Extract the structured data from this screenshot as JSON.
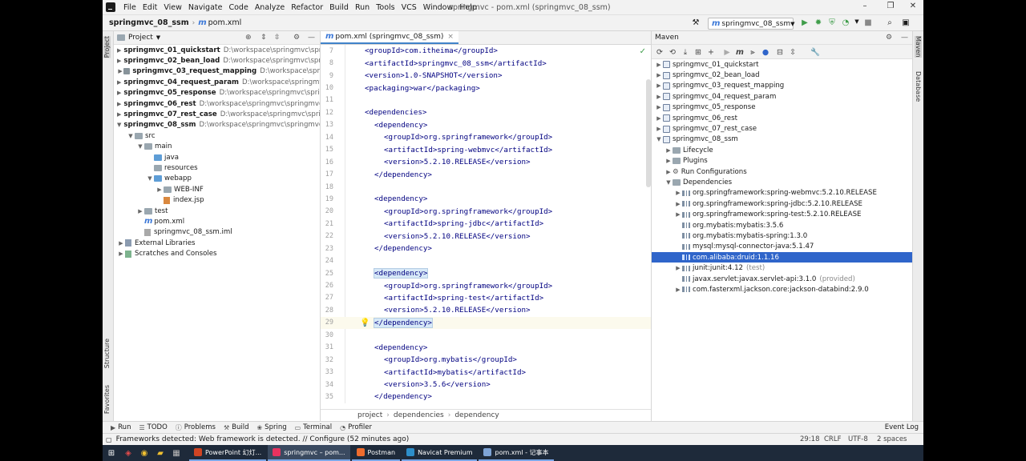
{
  "menubar": {
    "items": [
      "File",
      "Edit",
      "View",
      "Navigate",
      "Code",
      "Analyze",
      "Refactor",
      "Build",
      "Run",
      "Tools",
      "VCS",
      "Window",
      "Help"
    ],
    "title": "springmvc - pom.xml (springmvc_08_ssm)"
  },
  "navbar": {
    "project": "springmvc_08_ssm",
    "file": "pom.xml",
    "run_config": "springmvc_08_ssm"
  },
  "left_tabs": {
    "project": "Project",
    "structure": "Structure",
    "favorites": "Favorites"
  },
  "right_tabs": {
    "maven": "Maven",
    "database": "Database"
  },
  "project_panel": {
    "title": "Project",
    "modules": [
      {
        "name": "springmvc_01_quickstart",
        "path": "D:\\workspace\\springmvc\\spr"
      },
      {
        "name": "springmvc_02_bean_load",
        "path": "D:\\workspace\\springmvc\\spr"
      },
      {
        "name": "springmvc_03_request_mapping",
        "path": "D:\\workspace\\spr"
      },
      {
        "name": "springmvc_04_request_param",
        "path": "D:\\workspace\\springmv"
      },
      {
        "name": "springmvc_05_response",
        "path": "D:\\workspace\\springmvc\\sprin"
      },
      {
        "name": "springmvc_06_rest",
        "path": "D:\\workspace\\springmvc\\springmvc"
      },
      {
        "name": "springmvc_07_rest_case",
        "path": "D:\\workspace\\springmvc\\spri"
      },
      {
        "name": "springmvc_08_ssm",
        "path": "D:\\workspace\\springmvc\\springmvc"
      }
    ],
    "tree": {
      "src": "src",
      "main": "main",
      "java": "java",
      "resources": "resources",
      "webapp": "webapp",
      "webinf": "WEB-INF",
      "indexjsp": "index.jsp",
      "test": "test",
      "pom": "pom.xml",
      "iml": "springmvc_08_ssm.iml",
      "external": "External Libraries",
      "scratches": "Scratches and Consoles"
    }
  },
  "editor": {
    "tab": "pom.xml (springmvc_08_ssm)",
    "lines": [
      {
        "n": "7",
        "indent": 0,
        "code": "<groupId>com.itheima</groupId>"
      },
      {
        "n": "8",
        "indent": 0,
        "code": "<artifactId>springmvc_08_ssm</artifactId>"
      },
      {
        "n": "9",
        "indent": 0,
        "code": "<version>1.0-SNAPSHOT</version>"
      },
      {
        "n": "10",
        "indent": 0,
        "code": "<packaging>war</packaging>"
      },
      {
        "n": "11",
        "indent": 0,
        "code": ""
      },
      {
        "n": "12",
        "indent": 0,
        "code": "<dependencies>"
      },
      {
        "n": "13",
        "indent": 1,
        "code": "<dependency>"
      },
      {
        "n": "14",
        "indent": 2,
        "code": "<groupId>org.springframework</groupId>"
      },
      {
        "n": "15",
        "indent": 2,
        "code": "<artifactId>spring-webmvc</artifactId>"
      },
      {
        "n": "16",
        "indent": 2,
        "code": "<version>5.2.10.RELEASE</version>"
      },
      {
        "n": "17",
        "indent": 1,
        "code": "</dependency>"
      },
      {
        "n": "18",
        "indent": 0,
        "code": ""
      },
      {
        "n": "19",
        "indent": 1,
        "code": "<dependency>"
      },
      {
        "n": "20",
        "indent": 2,
        "code": "<groupId>org.springframework</groupId>"
      },
      {
        "n": "21",
        "indent": 2,
        "code": "<artifactId>spring-jdbc</artifactId>"
      },
      {
        "n": "22",
        "indent": 2,
        "code": "<version>5.2.10.RELEASE</version>"
      },
      {
        "n": "23",
        "indent": 1,
        "code": "</dependency>"
      },
      {
        "n": "24",
        "indent": 0,
        "code": ""
      },
      {
        "n": "25",
        "indent": 1,
        "code": "<dependency>",
        "hl": true
      },
      {
        "n": "26",
        "indent": 2,
        "code": "<groupId>org.springframework</groupId>"
      },
      {
        "n": "27",
        "indent": 2,
        "code": "<artifactId>spring-test</artifactId>"
      },
      {
        "n": "28",
        "indent": 2,
        "code": "<version>5.2.10.RELEASE</version>"
      },
      {
        "n": "29",
        "indent": 1,
        "code": "</dependency>",
        "hl": true,
        "current": true
      },
      {
        "n": "30",
        "indent": 0,
        "code": ""
      },
      {
        "n": "31",
        "indent": 1,
        "code": "<dependency>"
      },
      {
        "n": "32",
        "indent": 2,
        "code": "<groupId>org.mybatis</groupId>"
      },
      {
        "n": "33",
        "indent": 2,
        "code": "<artifactId>mybatis</artifactId>"
      },
      {
        "n": "34",
        "indent": 2,
        "code": "<version>3.5.6</version>"
      },
      {
        "n": "35",
        "indent": 1,
        "code": "</dependency>"
      }
    ],
    "breadcrumbs": [
      "project",
      "dependencies",
      "dependency"
    ]
  },
  "maven": {
    "title": "Maven",
    "projects": [
      "springmvc_01_quickstart",
      "springmvc_02_bean_load",
      "springmvc_03_request_mapping",
      "springmvc_04_request_param",
      "springmvc_05_response",
      "springmvc_06_rest",
      "springmvc_07_rest_case",
      "springmvc_08_ssm"
    ],
    "sections": {
      "lifecycle": "Lifecycle",
      "plugins": "Plugins",
      "run_configs": "Run Configurations",
      "dependencies": "Dependencies"
    },
    "deps": [
      {
        "name": "org.springframework:spring-webmvc:5.2.10.RELEASE",
        "expandable": true
      },
      {
        "name": "org.springframework:spring-jdbc:5.2.10.RELEASE",
        "expandable": true
      },
      {
        "name": "org.springframework:spring-test:5.2.10.RELEASE",
        "expandable": true
      },
      {
        "name": "org.mybatis:mybatis:3.5.6",
        "expandable": false
      },
      {
        "name": "org.mybatis:mybatis-spring:1.3.0",
        "expandable": false
      },
      {
        "name": "mysql:mysql-connector-java:5.1.47",
        "expandable": false
      },
      {
        "name": "com.alibaba:druid:1.1.16",
        "expandable": false,
        "selected": true
      },
      {
        "name": "junit:junit:4.12",
        "scope": "(test)",
        "expandable": true
      },
      {
        "name": "javax.servlet:javax.servlet-api:3.1.0",
        "scope": "(provided)",
        "expandable": false
      },
      {
        "name": "com.fasterxml.jackson.core:jackson-databind:2.9.0",
        "expandable": true
      }
    ]
  },
  "bottom_tabs": [
    "Run",
    "TODO",
    "Problems",
    "Build",
    "Spring",
    "Terminal",
    "Profiler"
  ],
  "event_log": "Event Log",
  "status": {
    "message": "Frameworks detected: Web framework is detected. // Configure (52 minutes ago)",
    "position": "29:18",
    "line_sep": "CRLF",
    "encoding": "UTF-8",
    "indent": "2 spaces"
  },
  "taskbar": {
    "apps": [
      {
        "label": "PowerPoint 幻灯...",
        "color": "#d04423"
      },
      {
        "label": "springmvc – pom...",
        "color": "#e8325f",
        "active": true
      },
      {
        "label": "Postman",
        "color": "#ef6c2d"
      },
      {
        "label": "Navicat Premium",
        "color": "#2d8ec9"
      },
      {
        "label": "pom.xml - 记事本",
        "color": "#7ea4d6"
      }
    ]
  }
}
